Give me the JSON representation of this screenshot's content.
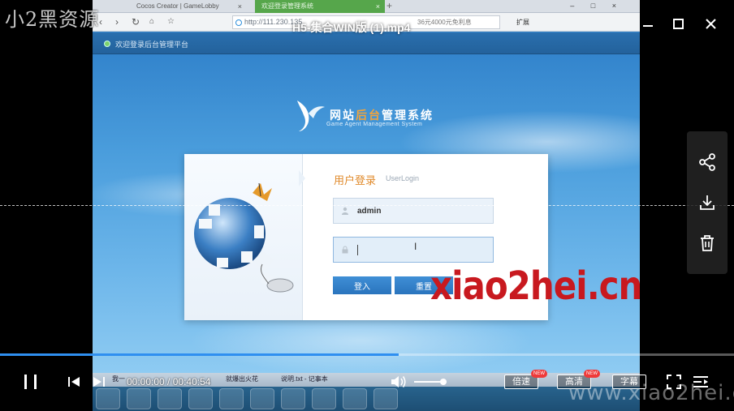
{
  "browser": {
    "tabs": [
      {
        "label": "Cocos Creator | GameLobby"
      },
      {
        "label": "欢迎登录管理系统"
      }
    ],
    "address": "http://111.230.135",
    "search_hint": "36元4000元免利息",
    "extension_label": "扩展"
  },
  "page": {
    "welcome_text": "欢迎登录后台管理平台",
    "logo": {
      "cn_part1": "网站",
      "cn_part2": "后台",
      "cn_part3": "管理系统",
      "en": "Game Agent Management System"
    },
    "login": {
      "title": "用户登录",
      "subtitle": "UserLogin",
      "username_value": "admin",
      "login_button": "登入",
      "reset_button": "重置"
    },
    "red_watermark": "xiao2hei.cn"
  },
  "taskbar": {
    "items": [
      "我一",
      "就爆出火花",
      "说明.txt - 记事本"
    ]
  },
  "player": {
    "corner_watermark": "小2黑资源",
    "video_title": "H5-集合WIN版 (1).mp4",
    "time_current": "00:00:00",
    "time_total": "00:40:54",
    "time_separator": " / ",
    "progress_fraction": 0.543,
    "volume_fraction": 0.9,
    "speed_label": "倍速",
    "hd_label": "高清",
    "subtitle_label": "字幕",
    "new_badge": "NEW",
    "bottom_watermark": "www.xiao2hei.cn",
    "accent_color": "#2f8ff0"
  }
}
